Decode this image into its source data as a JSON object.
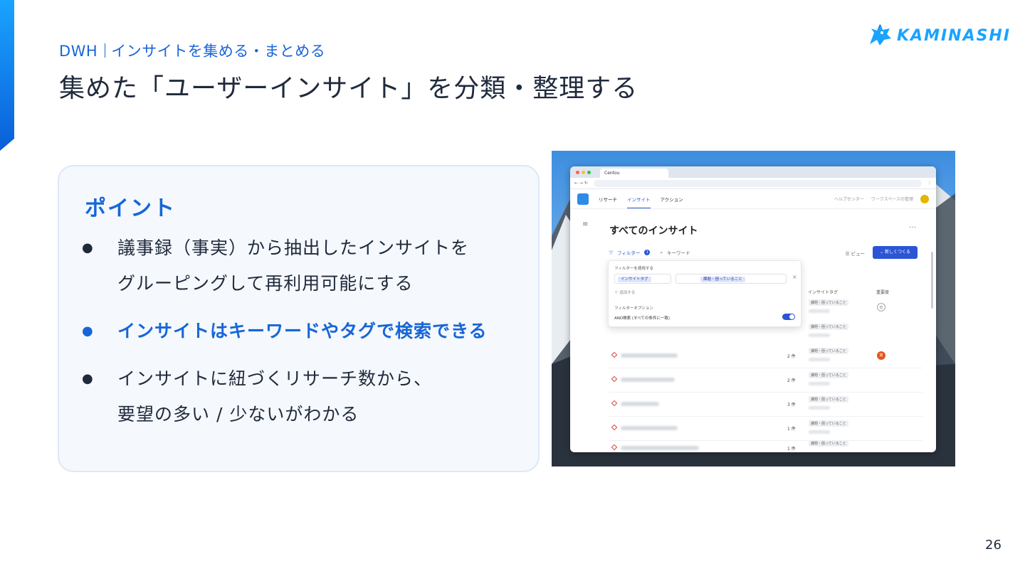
{
  "header": {
    "section": "DWH",
    "subtitle": "インサイトを集める・まとめる",
    "title": "集めた「ユーザーインサイト」を分類・整理する",
    "logo_text": "KAMINASHI"
  },
  "card": {
    "heading": "ポイント",
    "bullet": "●",
    "points": [
      {
        "lines": [
          "議事録（事実）から抽出したインサイトを",
          "グルーピングして再利用可能にする"
        ],
        "highlight": false
      },
      {
        "lines": [
          "インサイトはキーワードやタグで検索できる"
        ],
        "highlight": true
      },
      {
        "lines": [
          "インサイトに紐づくリサーチ数から、",
          "要望の多い / 少ないがわかる"
        ],
        "highlight": false
      }
    ]
  },
  "screenshot": {
    "browser_tab": "Centou",
    "nav_tabs": [
      "リサーチ",
      "インサイト",
      "アクション"
    ],
    "nav_right": [
      "ヘルプセンター",
      "ワークスペースの管理"
    ],
    "page_title": "すべてのインサイト",
    "more": "…",
    "filter_label": "フィルター",
    "filter_count": "1",
    "keyword_label": "キーワード",
    "view_label": "ビュー",
    "new_button": "新しくつくる",
    "popover": {
      "apply_label": "フィルターを適用する",
      "chip1": "インサイトタグ",
      "chip2": "課題・困っていること",
      "add_label": "＋ 追加する",
      "options_label": "フィルターオプション",
      "and_label": "AND検索 (すべての条件に一致)"
    },
    "columns": {
      "tag": "インサイトタグ",
      "priority": "重要度"
    },
    "rows": [
      {
        "count": "",
        "tag": "課題・困っていること",
        "priority": "低",
        "priority_color": "#ffffff"
      },
      {
        "count": "",
        "tag": "課題・困っていること",
        "priority": "",
        "priority_color": ""
      },
      {
        "count": "2 件",
        "tag": "課題・困っていること",
        "priority": "高",
        "priority_color": "#e2571e"
      },
      {
        "count": "2 件",
        "tag": "課題・困っていること",
        "priority": "",
        "priority_color": ""
      },
      {
        "count": "3 件",
        "tag": "課題・困っていること",
        "priority": "",
        "priority_color": ""
      },
      {
        "count": "1 件",
        "tag": "課題・困っていること",
        "priority": "",
        "priority_color": ""
      },
      {
        "count": "1 件",
        "tag": "課題・困っていること",
        "priority": "",
        "priority_color": ""
      }
    ]
  },
  "page_number": "26",
  "colors": {
    "accent": "#1766d8",
    "text": "#1f2a3c",
    "card_bg": "#f5f8fc",
    "brand": "#1aa3ff"
  }
}
